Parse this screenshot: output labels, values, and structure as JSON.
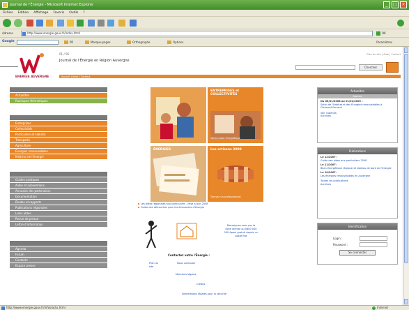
{
  "browser": {
    "title": "Journal de l'Énergie - Microsoft Internet Explorer",
    "menu": [
      "Fichier",
      "Edition",
      "Affichage",
      "Favoris",
      "Outils",
      "?"
    ],
    "address_label": "Adresse",
    "address_value": "http://www.energie.gouv.fr/index.html",
    "go_label": "OK",
    "google_label": "Google",
    "google_search_value": "",
    "links": [
      "PR",
      "Marque-pages",
      "Orthographe",
      "Options"
    ],
    "params_label": "Paramètres",
    "status_text": "http://www.energie.gouv.fr/infos/actu.html",
    "status_zone": "Internet"
  },
  "site": {
    "date": "01 / 06",
    "title": "Journal de l'Énergie en Région Auvergne",
    "band_text": "Accueil  |  Infos  |  Contact",
    "top_links": "Plan du site  |  Aide  |  Contact",
    "search_button": "Chercher",
    "logo_text": "ENERGIE AUVERGNE"
  },
  "left_nav": {
    "block1": [
      "Actualités",
      "Rubriques thématiques"
    ],
    "block2": [
      "Entreprises",
      "Collectivités",
      "Particuliers et Habitat",
      "Transports",
      "Agriculture",
      "Énergies renouvelables",
      "Maîtrise de l'énergie"
    ],
    "block3": [
      "Guides pratiques",
      "Aides et subventions",
      "Annuaire des partenaires",
      "Documentation",
      "Études et rapports",
      "Publications régionales",
      "Liens utiles",
      "Revue de presse",
      "Lettre d'information"
    ],
    "block4": [
      "Agenda",
      "Forum",
      "Contacts",
      "Espace presse"
    ]
  },
  "center": {
    "tiles": [
      {
        "caption": "",
        "sub": ""
      },
      {
        "caption": "ENTREPRISES et COLLECTIVITÉS",
        "sub": "Votre projet énergétique"
      },
      {
        "caption": "ÉNERGIES",
        "sub": ""
      },
      {
        "caption": "Les artisans 2008",
        "sub": "Trouvez un professionnel"
      }
    ],
    "links": [
      "Les aides régionales aux particuliers - Mise à jour 2008",
      "Guide des démarches pour les économies d'énergie"
    ],
    "contact_caption": "Contactez votre l'Énergie :",
    "phone_block": "Renseignez-vous par la ligne directe au 0800 000 000 Appel gratuit depuis un poste fixe",
    "small_links": [
      "Plan du site",
      "Nous contacter",
      "Mentions légales",
      "Crédits",
      "Informations légales pour la sécurité"
    ]
  },
  "right_col": {
    "box1_header": "Actualités",
    "box1_sub": "Agenda",
    "box1_date": "Du 05/01/2008 au 01/01/2009 :",
    "box1_text": "Salon de l'Habitat et des Énergies renouvelables à Clermont-Ferrand",
    "box1_link1": "Voir l'agenda",
    "box1_link2": "Archives",
    "box2_header": "Publications",
    "box2_items": [
      {
        "date": "Le 12/2007 :",
        "text": "Guide des aides aux particuliers 2008"
      },
      {
        "date": "Le 11/2007 :",
        "text": "Bilan énergétique régional et tableau de bord de l'énergie"
      },
      {
        "date": "Le 10/2007 :",
        "text": "Les énergies renouvelables en Auvergne"
      }
    ],
    "box2_link1": "Toutes les publications",
    "box2_link2": "Archives",
    "box3_header": "Identification",
    "login_label": "Login :",
    "password_label": "Password :",
    "login_button": "Se connecter"
  },
  "colors": {
    "orange": "#e8872a",
    "green": "#8ab14a",
    "gray": "#8f8f8f",
    "brand_red": "#c8102e"
  }
}
